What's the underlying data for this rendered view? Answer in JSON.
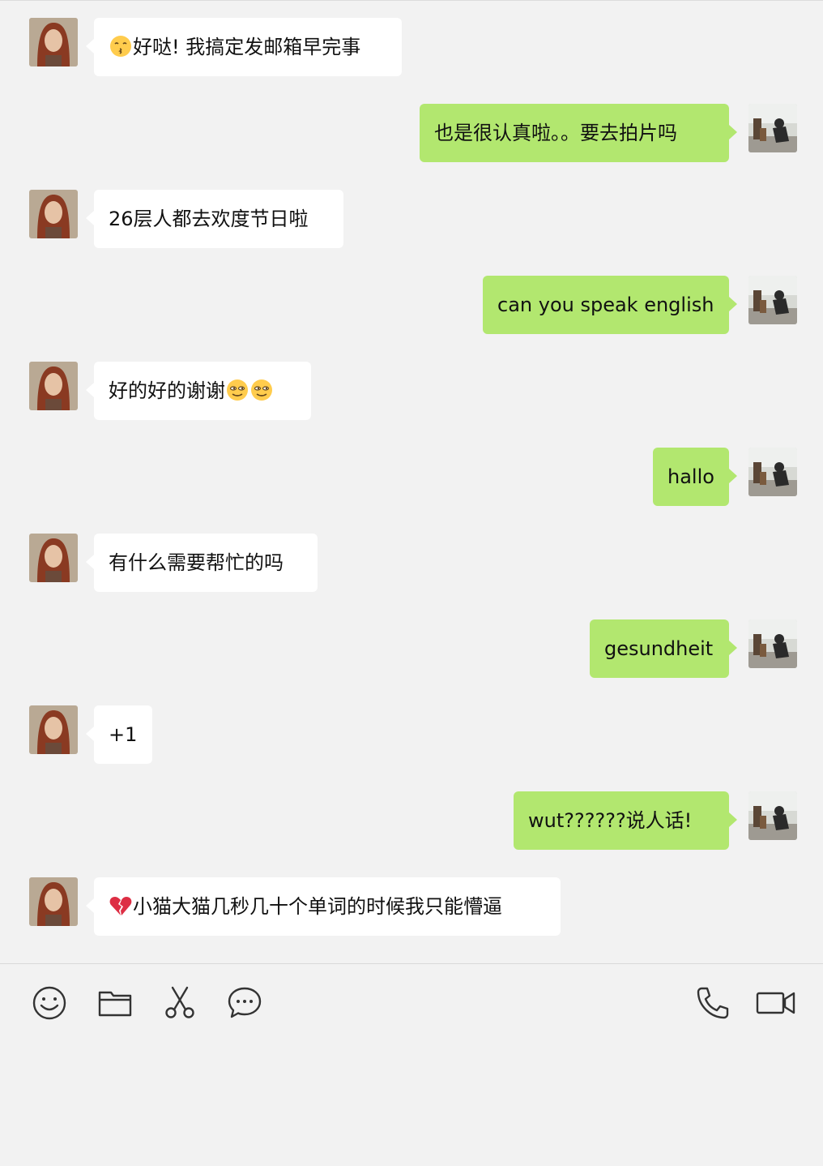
{
  "colors": {
    "background": "#f2f2f2",
    "received_bubble": "#ffffff",
    "sent_bubble": "#b2e76f",
    "icon_stroke": "#333333"
  },
  "messages": [
    {
      "side": "left",
      "emoji": "kissing-face",
      "text": "好哒! 我搞定发邮箱早完事"
    },
    {
      "side": "right",
      "text": "也是很认真啦。。要去拍片吗"
    },
    {
      "side": "left",
      "text": "26层人都去欢度节日啦"
    },
    {
      "side": "right",
      "text": "can you speak english"
    },
    {
      "side": "left",
      "text": "好的好的谢谢",
      "trailing_emoji": [
        "smirk-face",
        "smirk-face"
      ]
    },
    {
      "side": "right",
      "text": "hallo"
    },
    {
      "side": "left",
      "text": "有什么需要帮忙的吗"
    },
    {
      "side": "right",
      "text": "gesundheit"
    },
    {
      "side": "left",
      "text": "+1"
    },
    {
      "side": "right",
      "text": "wut??????说人话!"
    },
    {
      "side": "left",
      "emoji": "broken-heart",
      "text": "小猫大猫几秒几十个单词的时候我只能懵逼"
    }
  ],
  "toolbar": {
    "left_icons": [
      "emoji-icon",
      "folder-icon",
      "scissors-icon",
      "chat-bubble-icon"
    ],
    "right_icons": [
      "phone-icon",
      "video-camera-icon"
    ]
  },
  "input": {
    "value": ""
  }
}
